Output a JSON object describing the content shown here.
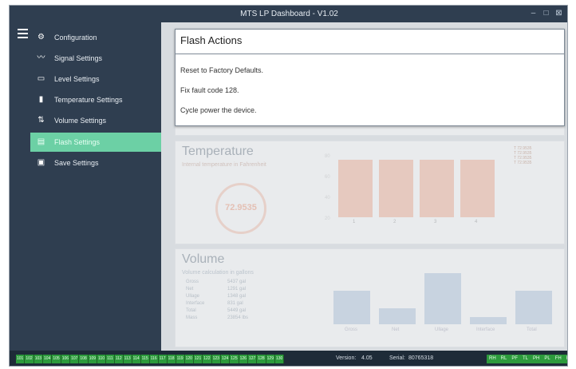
{
  "window": {
    "title": "MTS LP Dashboard - V1.02",
    "controls": [
      "minimize",
      "maximize",
      "close"
    ]
  },
  "sidebar": {
    "items": [
      {
        "label": "Configuration",
        "icon": "gear-icon"
      },
      {
        "label": "Signal Settings",
        "icon": "signal-icon"
      },
      {
        "label": "Level Settings",
        "icon": "level-icon"
      },
      {
        "label": "Temperature Settings",
        "icon": "thermometer-icon"
      },
      {
        "label": "Volume Settings",
        "icon": "volume-icon"
      },
      {
        "label": "Flash Settings",
        "icon": "flash-icon",
        "active": true
      },
      {
        "label": "Save Settings",
        "icon": "save-icon"
      }
    ]
  },
  "modal": {
    "title": "Flash Actions",
    "actions": [
      "Reset to Factory Defaults.",
      "Fix fault code 128.",
      "Cycle power the device."
    ]
  },
  "temperature": {
    "title": "Temperature",
    "subtitle": "Internal temperature in Fahrenheit",
    "gauge_value": "72.9535",
    "legend": [
      "Τ 72.9535",
      "Τ 72.9535",
      "Τ 72.9535",
      "Τ 72.9535"
    ],
    "bar_labels": [
      "1",
      "2",
      "3",
      "4"
    ],
    "y_labels": [
      "80",
      "60",
      "40",
      "20"
    ]
  },
  "volume": {
    "title": "Volume",
    "subtitle": "Volume calculation in gallons",
    "rows": [
      {
        "label": "Gross",
        "value": "5437 gal"
      },
      {
        "label": "Net",
        "value": "1291 gal"
      },
      {
        "label": "Ullage",
        "value": "1348 gal"
      },
      {
        "label": "Interface",
        "value": "831 gal"
      },
      {
        "label": "Total",
        "value": "5449 gal"
      },
      {
        "label": "Mass",
        "value": "23854 lbs"
      }
    ],
    "bar_labels": [
      "Gross",
      "Net",
      "Ullage",
      "Interface",
      "Total"
    ]
  },
  "status": {
    "numbers": [
      "101",
      "102",
      "103",
      "104",
      "105",
      "106",
      "107",
      "108",
      "109",
      "110",
      "111",
      "112",
      "113",
      "114",
      "115",
      "116",
      "117",
      "118",
      "119",
      "120",
      "121",
      "122",
      "123",
      "124",
      "125",
      "126",
      "127",
      "128",
      "129",
      "130"
    ],
    "version_label": "Version:",
    "version": "4.05",
    "serial_label": "Serial:",
    "serial": "80765318",
    "flags": [
      "RH",
      "RL",
      "PF",
      "TL",
      "PH",
      "PL",
      "FH",
      "FL"
    ]
  },
  "colors": {
    "sidebar_bg": "#2f3e50",
    "active_item": "#6cd0a5",
    "temp_bar": "#f4b8a0",
    "volume_bar": "#b9cbe0",
    "status_green": "#2c9a3c"
  }
}
